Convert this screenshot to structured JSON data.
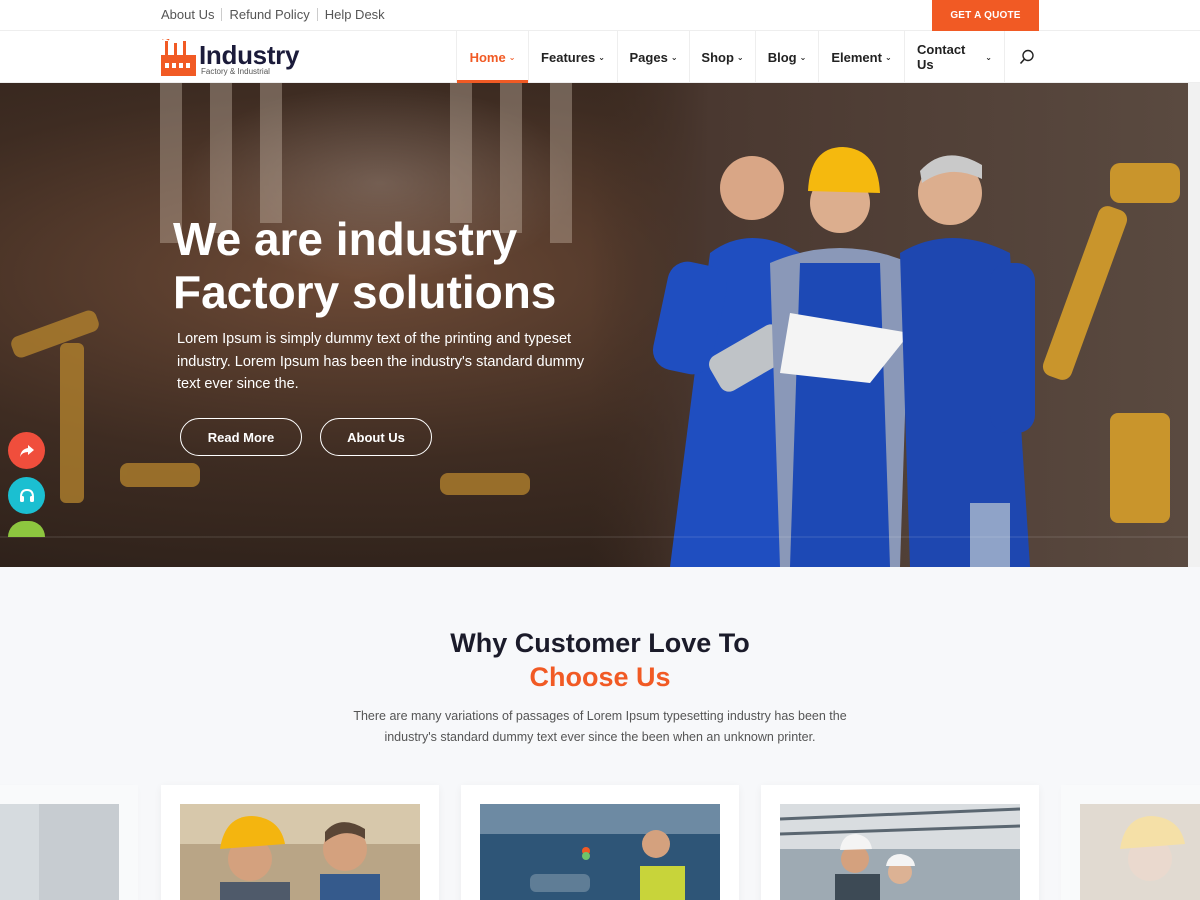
{
  "topbar": {
    "links": [
      "About Us",
      "Refund Policy",
      "Help Desk"
    ],
    "quote_button": "GET A QUOTE"
  },
  "logo": {
    "title": "Industry",
    "subtitle": "Factory & Industrial"
  },
  "nav": {
    "items": [
      "Home",
      "Features",
      "Pages",
      "Shop",
      "Blog",
      "Element",
      "Contact Us"
    ],
    "active": "Home"
  },
  "hero": {
    "title_line1": "We are industry",
    "title_line2": "Factory solutions",
    "text": "Lorem Ipsum is simply dummy text of the printing and typeset industry. Lorem Ipsum has been the industry's standard dummy text ever since the.",
    "button_primary": "Read More",
    "button_secondary": "About Us"
  },
  "why": {
    "title": "Why Customer Love To",
    "title_highlight": "Choose Us",
    "text": "There are many variations of passages of Lorem Ipsum typesetting industry has been the industry's standard dummy text ever since the been when an unknown printer."
  },
  "colors": {
    "accent": "#f15a24",
    "dark": "#1b1b3a",
    "share": "#f04e3c",
    "support": "#1bbfd1",
    "green": "#8dc63f"
  },
  "icons": [
    "factory-logo-icon",
    "chevron-down-icon",
    "search-icon",
    "share-icon",
    "headset-icon"
  ]
}
